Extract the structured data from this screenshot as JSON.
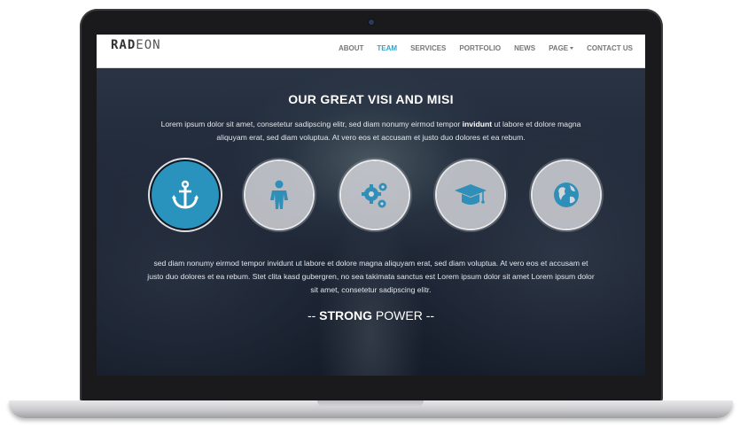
{
  "brand": {
    "logo_bold": "RAD",
    "logo_light": "EON"
  },
  "nav": {
    "items": [
      {
        "label": "ABOUT"
      },
      {
        "label": "TEAM"
      },
      {
        "label": "SERVICES"
      },
      {
        "label": "PORTFOLIO"
      },
      {
        "label": "NEWS"
      },
      {
        "label": "PAGE"
      },
      {
        "label": "CONTACT US"
      }
    ],
    "active": "TEAM",
    "active_color": "#33a3c8"
  },
  "hero": {
    "title": "OUR GREAT VISI AND MISI",
    "intro_before": "Lorem ipsum dolor sit amet, consetetur sadipscing elitr, sed diam nonumy eirmod tempor",
    "intro_bold": "invidunt",
    "intro_after": "ut labore et dolore magna aliquyam erat, sed diam voluptua. At vero eos et accusam et justo duo dolores et ea rebum.",
    "circles": [
      {
        "icon": "anchor-icon",
        "active": true
      },
      {
        "icon": "person-icon",
        "active": false
      },
      {
        "icon": "gears-icon",
        "active": false
      },
      {
        "icon": "graduation-cap-icon",
        "active": false
      },
      {
        "icon": "globe-icon",
        "active": false
      }
    ],
    "accent_color": "#2993bd",
    "body": "sed diam nonumy eirmod tempor invidunt ut labore et dolore magna aliquyam erat, sed diam voluptua. At vero eos et accusam et justo duo dolores et ea rebum. Stet clita kasd gubergren, no sea takimata sanctus est Lorem ipsum dolor sit amet Lorem ipsum dolor sit amet, consetetur sadipscing elitr.",
    "strong_prefix": "-- ",
    "strong_bold": "STRONG",
    "strong_suffix": " POWER --"
  }
}
